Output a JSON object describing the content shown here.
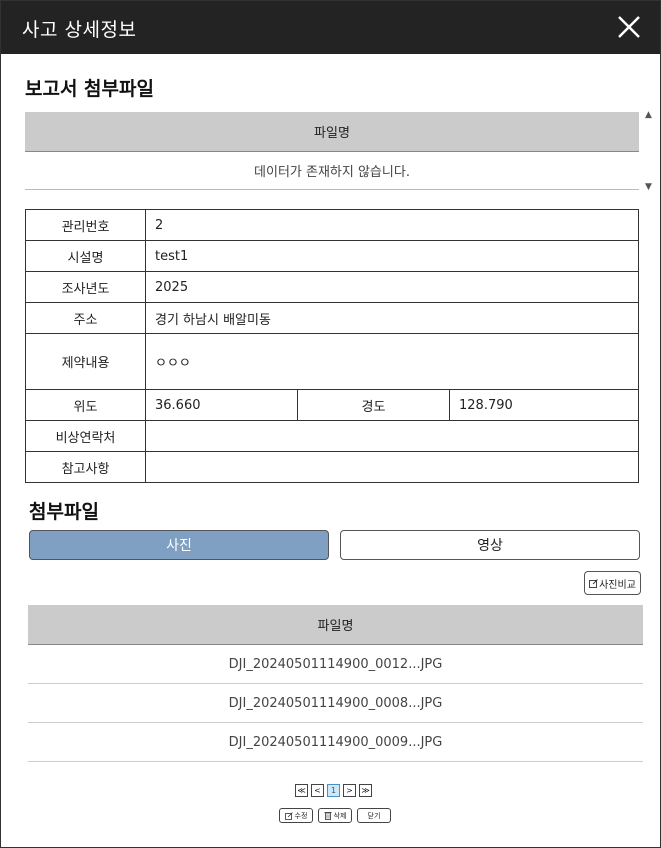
{
  "window": {
    "title": "사고 상세정보",
    "close_icon": "close-icon"
  },
  "report_section": {
    "title": "보고서 첨부파일",
    "column_header": "파일명",
    "empty_message": "데이터가 존재하지 않습니다.",
    "scroll_up": "▲",
    "scroll_down": "▼"
  },
  "details": {
    "mgmt_no_label": "관리번호",
    "mgmt_no_value": "2",
    "facility_label": "시설명",
    "facility_value": "test1",
    "year_label": "조사년도",
    "year_value": "2025",
    "address_label": "주소",
    "address_value": "경기 하남시 배알미동",
    "content_label": "제약내용",
    "content_value": "ㅇㅇㅇ",
    "lat_label": "위도",
    "lat_value": "36.660",
    "lng_label": "경도",
    "lng_value": "128.790",
    "emergency_label": "비상연락처",
    "emergency_value": "",
    "note_label": "참고사항",
    "note_value": ""
  },
  "attach_section": {
    "title": "첨부파일",
    "tab_photo": "사진",
    "tab_video": "영상",
    "compare_button": "사진비교",
    "column_header": "파일명",
    "files": [
      "DJI_20240501114900_0012...JPG",
      "DJI_20240501114900_0008...JPG",
      "DJI_20240501114900_0009...JPG"
    ]
  },
  "pagination": {
    "first": "≪",
    "prev": "<",
    "current": "1",
    "next": ">",
    "last": "≫"
  },
  "actions": {
    "edit": "수정",
    "delete": "삭제",
    "close": "닫기"
  },
  "colors": {
    "header_bg": "#232323",
    "active_tab": "#7f9fc3",
    "table_header": "#cbcbcb"
  }
}
